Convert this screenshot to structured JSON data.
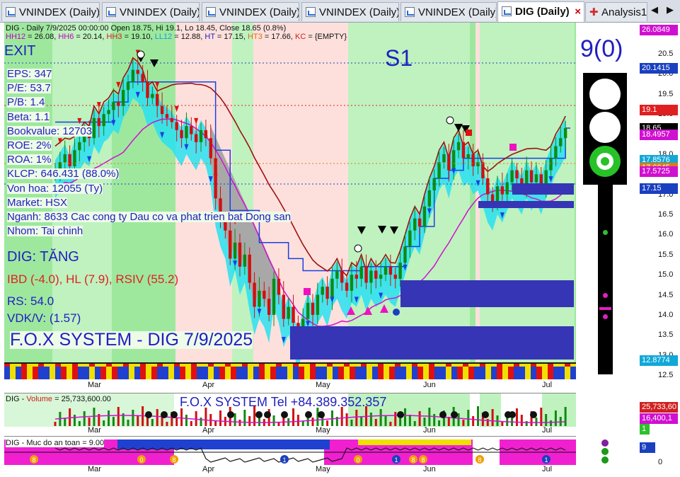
{
  "tabs": [
    {
      "label": "VNINDEX (Daily)"
    },
    {
      "label": "VNINDEX (Daily)"
    },
    {
      "label": "VNINDEX (Daily)"
    },
    {
      "label": "VNINDEX (Daily)"
    },
    {
      "label": "VNINDEX (Daily)"
    },
    {
      "label": "DIG (Daily)",
      "close": "×"
    },
    {
      "label": "Analysis1"
    }
  ],
  "tab_nav": {
    "left": "◀",
    "right": "▶"
  },
  "header": {
    "line1": "DIG - Daily 7/9/2025 00:00:00 Open 18.75, Hi 19.1, Lo 18.45, Close 18.65 (0.8%)",
    "line2": [
      {
        "t": "HH12",
        "c": "#c000c0"
      },
      {
        "t": " = 26.08, ",
        "c": "#111"
      },
      {
        "t": "HH6",
        "c": "#c000c0"
      },
      {
        "t": " = 20.14, ",
        "c": "#111"
      },
      {
        "t": "HH3",
        "c": "#d02020"
      },
      {
        "t": " = 19.10, ",
        "c": "#111"
      },
      {
        "t": "LL12",
        "c": "#10a0e0"
      },
      {
        "t": " = 12.88, ",
        "c": "#111"
      },
      {
        "t": "HT",
        "c": "#2020c0"
      },
      {
        "t": "  = 17.15, ",
        "c": "#111"
      },
      {
        "t": "HT3",
        "c": "#e07010"
      },
      {
        "t": " = 17.66, ",
        "c": "#111"
      },
      {
        "t": "KC",
        "c": "#d02020"
      },
      {
        "t": " = {EMPTY}",
        "c": "#111"
      }
    ]
  },
  "signal": "EXIT",
  "stage": "S1",
  "score": "9(0)",
  "fundamentals": [
    "EPS: 347",
    "P/E: 53.7",
    "P/B: 1.4",
    "Beta: 1.1",
    "Bookvalue: 12703",
    "ROE: 2%",
    "ROA: 1%",
    "KLCP: 646.431 (88.0%)",
    "Von hoa: 12055 (Ty)",
    "Market: HSX",
    "Nganh: 8633 Cac cong ty Dau co va phat trien bat Dong san",
    "Nhom: Tai chinh"
  ],
  "trend": "DIG: TĂNG",
  "ibd": "IBD (-4.0), HL (7.9), RSIV (55.2)",
  "rs": "RS: 54.0",
  "vdk": "VDK/V:  (1.57)",
  "brand": "F.O.X SYSTEM - DIG 7/9/2025",
  "contact": "F.O.X SYSTEM Tel +84.389.352.357",
  "price_axis": {
    "ticks": [
      "20.5",
      "20.0",
      "19.5",
      "19.0",
      "18.5",
      "18.0",
      "17.5",
      "17.0",
      "16.5",
      "16.0",
      "15.5",
      "15.0",
      "14.5",
      "14.0",
      "13.5",
      "13.0",
      "12.5"
    ]
  },
  "price_labels": [
    {
      "v": "26.0849",
      "c": "#d010d0"
    },
    {
      "v": "20.1415",
      "c": "#1a40c0"
    },
    {
      "v": "19.1",
      "c": "#e02020"
    },
    {
      "v": "18.65",
      "c": "#000000"
    },
    {
      "v": "18.4957",
      "c": "#d010d0"
    },
    {
      "v": "17.8576",
      "c": "#10a8d8"
    },
    {
      "v": "17.6645",
      "c": "#e07a10"
    },
    {
      "v": "17.5725",
      "c": "#d010d0"
    },
    {
      "v": "17.15",
      "c": "#1a40c0"
    },
    {
      "v": "12.8774",
      "c": "#10a8d8"
    }
  ],
  "months": [
    "Mar",
    "Apr",
    "May",
    "Jun",
    "Jul"
  ],
  "volume": {
    "title_prefix": "DIG - ",
    "title_series": "Volume",
    "title_value": " = 25,733,600.00",
    "last": "25,733,60",
    "avg": "16,400,1",
    "flag": "1"
  },
  "safety": {
    "title": "DIG - Muc do an toan = 9.00",
    "last": "9",
    "zero": "0",
    "markers": [
      "8",
      "0",
      "8",
      "1",
      "0",
      "1",
      "8",
      "8",
      "8",
      "1"
    ]
  },
  "chart_data": {
    "type": "candlestick",
    "title": "DIG - Daily 7/9/2025",
    "x": "trading days Feb–Jul 2025",
    "last": {
      "open": 18.75,
      "high": 19.1,
      "low": 18.45,
      "close": 18.65,
      "change_pct": 0.8
    },
    "ylim": [
      12.5,
      20.8
    ],
    "close_series": [
      17.6,
      17.8,
      18.0,
      17.7,
      18.1,
      18.3,
      18.5,
      18.4,
      18.9,
      18.7,
      19.0,
      19.1,
      19.3,
      19.2,
      19.6,
      19.8,
      20.1,
      20.0,
      19.8,
      19.4,
      19.5,
      19.2,
      19.0,
      18.9,
      18.8,
      18.6,
      18.4,
      18.7,
      18.5,
      18.3,
      18.6,
      18.4,
      17.9,
      16.9,
      16.4,
      16.1,
      15.4,
      15.8,
      15.2,
      15.5,
      14.8,
      14.2,
      14.6,
      14.4,
      14.0,
      14.9,
      14.5,
      13.9,
      14.2,
      13.8,
      13.3,
      13.9,
      14.3,
      14.0,
      14.5,
      14.7,
      14.4,
      14.9,
      15.1,
      14.8,
      14.6,
      15.0,
      14.9,
      15.2,
      14.8,
      15.1,
      14.9,
      15.0,
      15.2,
      15.0,
      14.9,
      15.3,
      15.7,
      16.1,
      16.4,
      16.2,
      16.7,
      17.1,
      17.4,
      17.8,
      18.0,
      17.6,
      18.1,
      18.3,
      17.9,
      18.0,
      17.7,
      17.8,
      17.4,
      17.0,
      16.8,
      17.2,
      17.0,
      17.3,
      17.6,
      17.4,
      17.2,
      17.6,
      17.3,
      17.5,
      17.2,
      17.6,
      17.9,
      18.2,
      18.4,
      18.65
    ],
    "volume_last": 25733600,
    "safety_last": 9
  }
}
